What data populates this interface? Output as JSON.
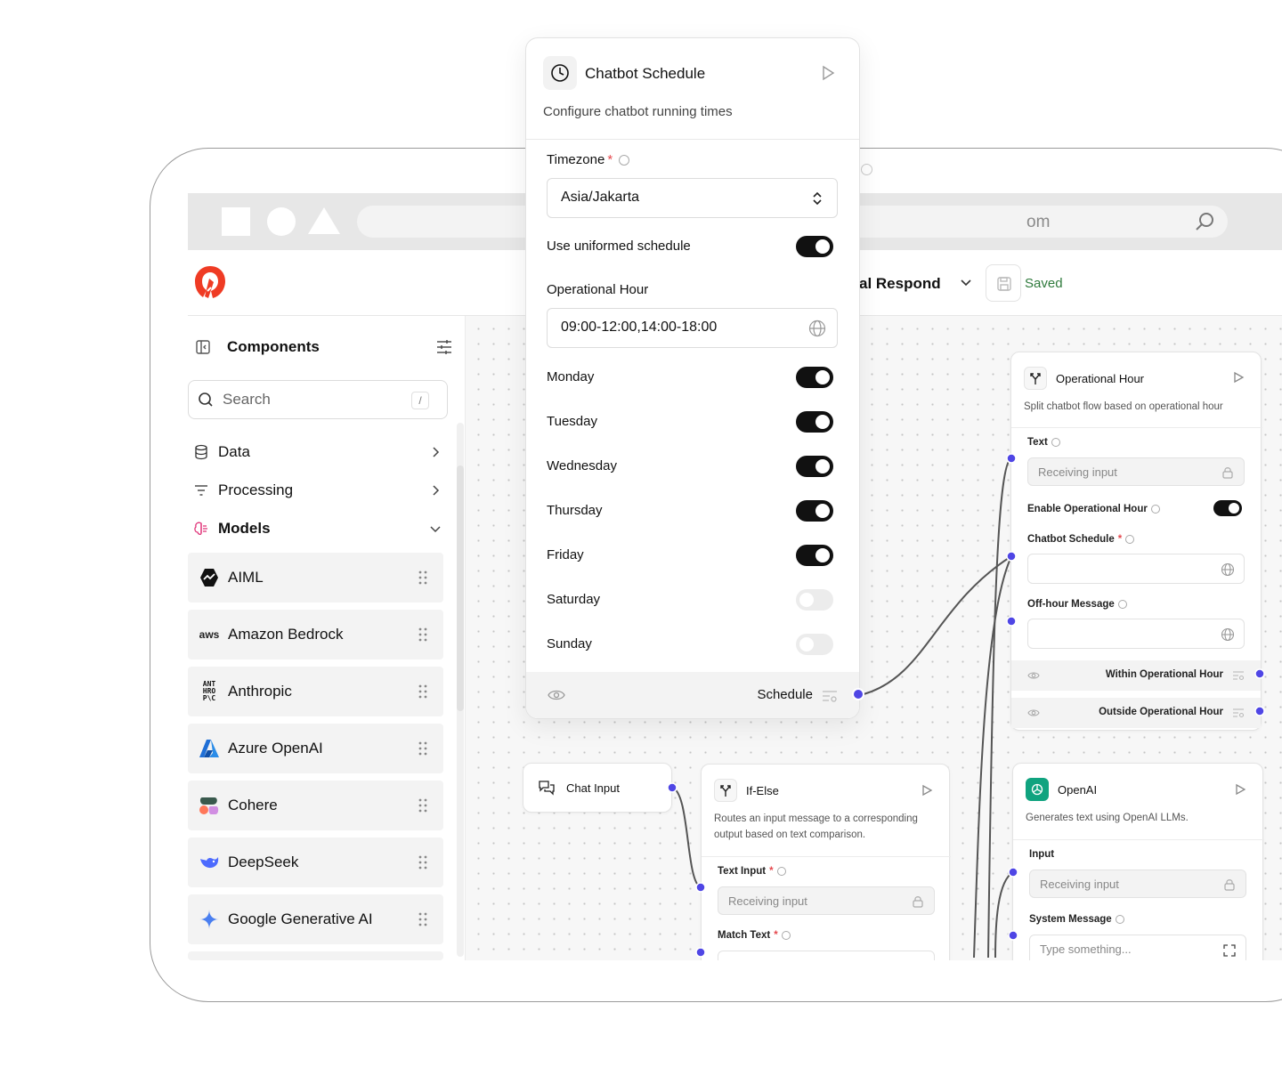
{
  "browser": {
    "url_fragment": "om"
  },
  "header": {
    "flow_title": "al Respond",
    "saved_label": "Saved"
  },
  "sidebar": {
    "title": "Components",
    "search_placeholder": "Search",
    "search_shortcut": "/",
    "categories": [
      {
        "label": "Data",
        "icon": "database-icon"
      },
      {
        "label": "Processing",
        "icon": "filter-icon"
      },
      {
        "label": "Models",
        "icon": "brain-icon"
      }
    ],
    "models": [
      {
        "label": "AIML",
        "icon": "aiml-logo"
      },
      {
        "label": "Amazon Bedrock",
        "icon": "aws-logo",
        "logo_text": "aws"
      },
      {
        "label": "Anthropic",
        "icon": "anthropic-logo",
        "logo_text": "ANT\nHRO\nP\\C"
      },
      {
        "label": "Azure OpenAI",
        "icon": "azure-logo"
      },
      {
        "label": "Cohere",
        "icon": "cohere-logo"
      },
      {
        "label": "DeepSeek",
        "icon": "deepseek-logo"
      },
      {
        "label": "Google Generative AI",
        "icon": "gemini-logo"
      }
    ]
  },
  "popup": {
    "title": "Chatbot Schedule",
    "description": "Configure chatbot running times",
    "timezone_label": "Timezone",
    "required_mark": "*",
    "timezone_value": "Asia/Jakarta",
    "uniform_label": "Use uniformed schedule",
    "uniform_on": true,
    "hours_label": "Operational Hour",
    "hours_value": "09:00-12:00,14:00-18:00",
    "days": [
      {
        "label": "Monday",
        "on": true
      },
      {
        "label": "Tuesday",
        "on": true
      },
      {
        "label": "Wednesday",
        "on": true
      },
      {
        "label": "Thursday",
        "on": true
      },
      {
        "label": "Friday",
        "on": true
      },
      {
        "label": "Saturday",
        "on": false
      },
      {
        "label": "Sunday",
        "on": false
      }
    ],
    "output_label": "Schedule"
  },
  "nodes": {
    "operational": {
      "title": "Operational Hour",
      "description": "Split chatbot flow based on operational hour",
      "text_label": "Text",
      "text_placeholder": "Receiving input",
      "enable_label": "Enable Operational Hour",
      "enable_on": true,
      "schedule_label": "Chatbot Schedule",
      "offhour_label": "Off-hour Message",
      "output_within": "Within Operational Hour",
      "output_outside": "Outside Operational Hour"
    },
    "chat_input": {
      "title": "Chat Input"
    },
    "ifelse": {
      "title": "If-Else",
      "description": "Routes an input message to a corresponding output based on text comparison.",
      "text_input_label": "Text Input",
      "text_input_placeholder": "Receiving input",
      "match_label": "Match Text"
    },
    "openai": {
      "title": "OpenAI",
      "description": "Generates text using OpenAI LLMs.",
      "input_label": "Input",
      "input_placeholder": "Receiving input",
      "system_label": "System Message",
      "system_placeholder": "Type something..."
    }
  },
  "colors": {
    "accent_handle": "#4f46e5",
    "brand_logo": "#ef3b24",
    "saved_green": "#2f7a3c",
    "required_red": "#e5484d"
  }
}
